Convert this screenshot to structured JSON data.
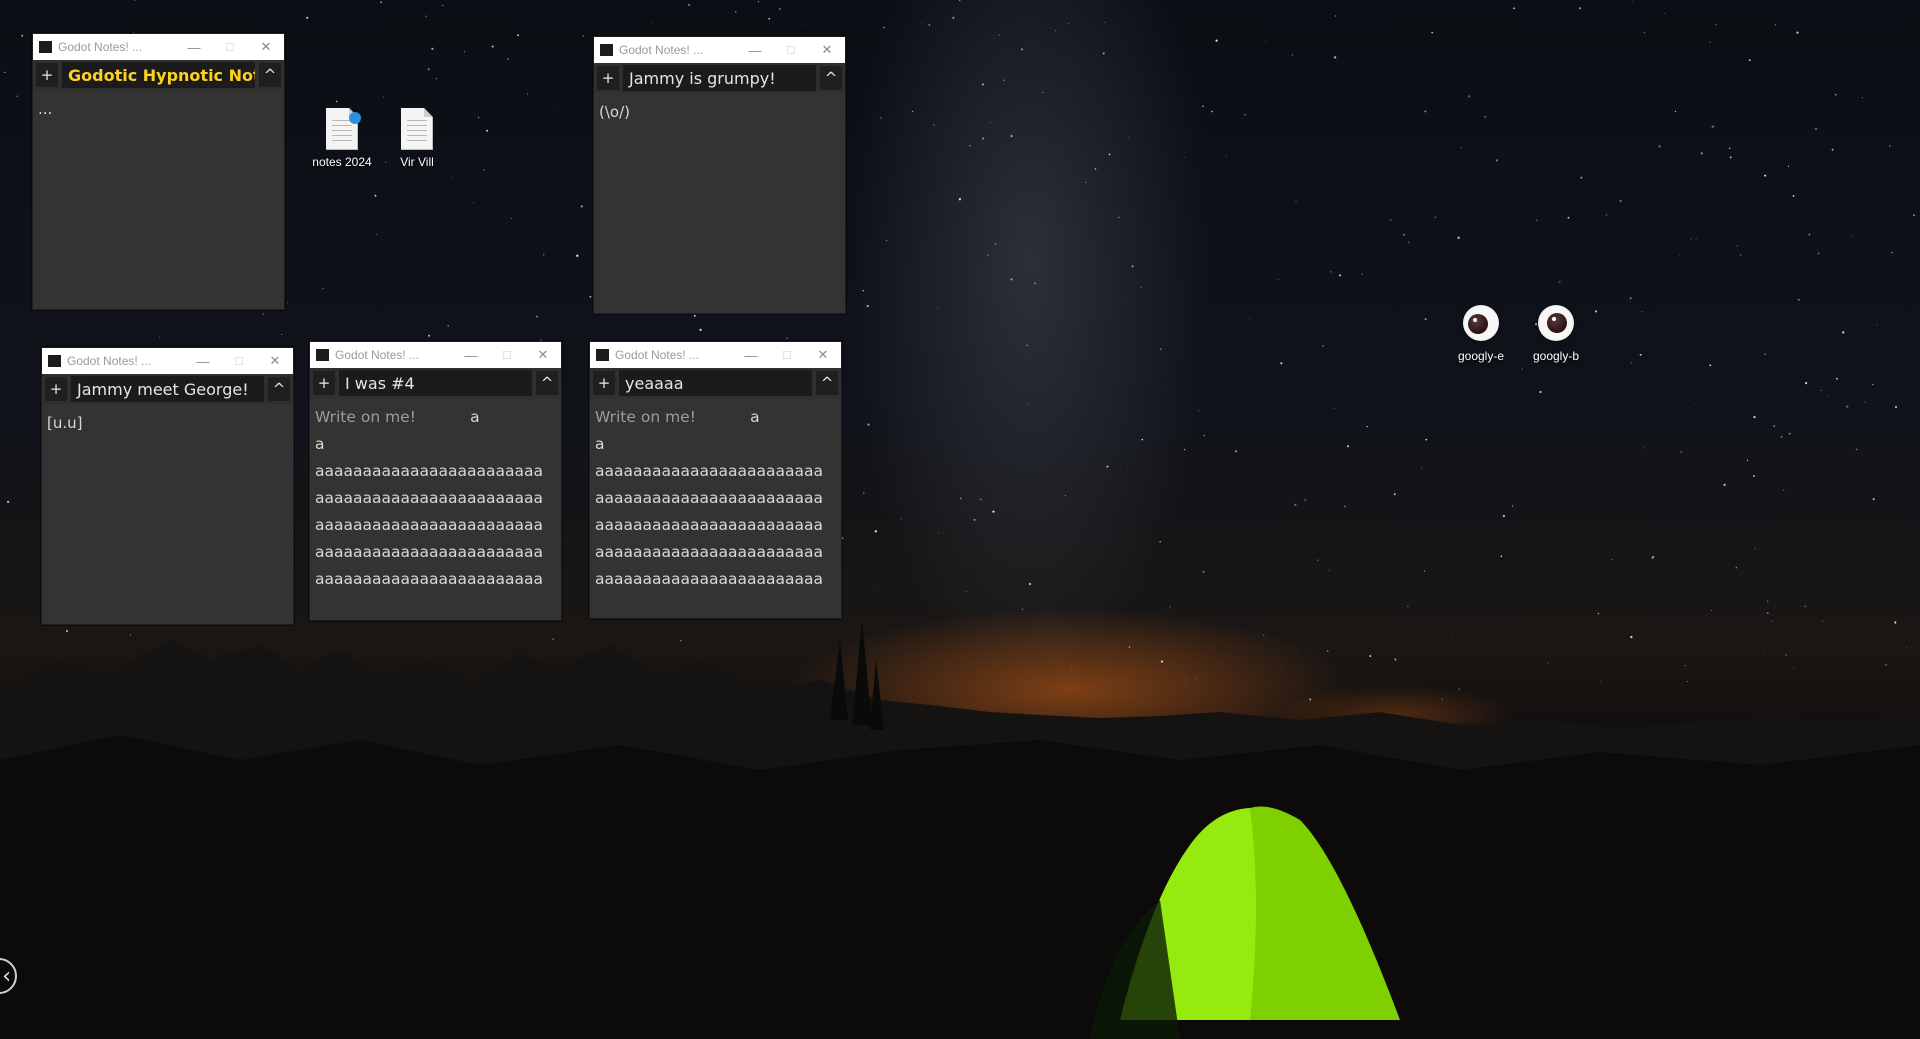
{
  "desktop": {
    "icons": [
      {
        "label": "notes 2024",
        "kind": "document-icon"
      },
      {
        "label": "Vir Vill",
        "kind": "document-icon"
      },
      {
        "label": "googly-e",
        "kind": "googly-eye-icon"
      },
      {
        "label": "googly-b",
        "kind": "googly-eye-icon"
      }
    ]
  },
  "window_common": {
    "titlebar_text": "Godot Notes! ...",
    "add_label": "+",
    "collapse_label": "^",
    "minimize_glyph": "—",
    "maximize_glyph": "☐",
    "close_glyph": "✕"
  },
  "notes": [
    {
      "title": "Godotic Hypnotic Notes",
      "title_color": "#ffd21e",
      "body": "...",
      "placeholder": ""
    },
    {
      "title": "Jammy is grumpy!",
      "body": "(\\o/)",
      "placeholder": ""
    },
    {
      "title": "Jammy meet George!",
      "body": "[u.u]",
      "placeholder": ""
    },
    {
      "title": "I was #4",
      "placeholder": "Write on me!",
      "body": "           a\na\naaaaaaaaaaaaaaaaaaaaaaaa\naaaaaaaaaaaaaaaaaaaaaaaa\naaaaaaaaaaaaaaaaaaaaaaaa\naaaaaaaaaaaaaaaaaaaaaaaa\naaaaaaaaaaaaaaaaaaaaaaaa"
    },
    {
      "title": "yeaaaa",
      "placeholder": "Write on me!",
      "body": "           a\na\naaaaaaaaaaaaaaaaaaaaaaaa\naaaaaaaaaaaaaaaaaaaaaaaa\naaaaaaaaaaaaaaaaaaaaaaaa\naaaaaaaaaaaaaaaaaaaaaaaa\naaaaaaaaaaaaaaaaaaaaaaaa"
    }
  ],
  "colors": {
    "note_background": "#333333",
    "title_field": "#1b1b1b",
    "highlight_title": "#ffd21e",
    "tent_green": "#7fd000"
  }
}
